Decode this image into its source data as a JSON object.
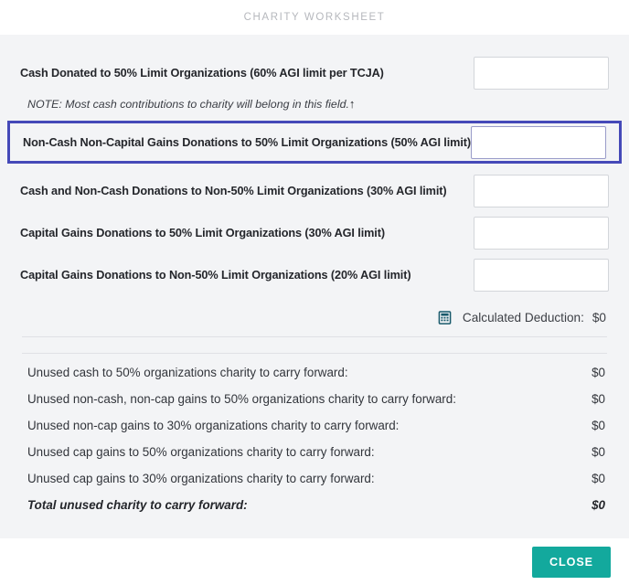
{
  "header": {
    "title": "CHARITY WORKSHEET"
  },
  "fields": [
    {
      "label": "Cash Donated to 50% Limit Organizations (60% AGI limit per TCJA)",
      "value": "",
      "placeholder": "",
      "highlighted": false
    },
    {
      "label": "Non-Cash Non-Capital Gains Donations to 50% Limit Organizations (50% AGI limit)",
      "value": "",
      "placeholder": "",
      "highlighted": true
    },
    {
      "label": "Cash and Non-Cash Donations to Non-50% Limit Organizations (30% AGI limit)",
      "value": "",
      "placeholder": "",
      "highlighted": false
    },
    {
      "label": "Capital Gains Donations to 50% Limit Organizations (30% AGI limit)",
      "value": "",
      "placeholder": "",
      "highlighted": false
    },
    {
      "label": "Capital Gains Donations to Non-50% Limit Organizations (20% AGI limit)",
      "value": "",
      "placeholder": "",
      "highlighted": false
    }
  ],
  "note": {
    "text": "NOTE: Most cash contributions to charity will belong in this field.",
    "arrow": "↑"
  },
  "calculated_deduction": {
    "icon": "calculator-icon",
    "label": "Calculated Deduction:",
    "value": "$0"
  },
  "carry_forward": [
    {
      "label": "Unused cash to 50% organizations charity to carry forward:",
      "value": "$0"
    },
    {
      "label": "Unused non-cash, non-cap gains to 50% organizations charity to carry forward:",
      "value": "$0"
    },
    {
      "label": "Unused non-cap gains to 30% organizations charity to carry forward:",
      "value": "$0"
    },
    {
      "label": "Unused cap gains to 50% organizations charity to carry forward:",
      "value": "$0"
    },
    {
      "label": "Unused cap gains to 30% organizations charity to carry forward:",
      "value": "$0"
    },
    {
      "label": "Total unused charity to carry forward:",
      "value": "$0"
    }
  ],
  "footer": {
    "close_label": "CLOSE"
  },
  "colors": {
    "accent_teal": "#13a99d",
    "highlight_blue": "#4549b8",
    "body_background": "#f3f4f6",
    "icon_teal": "#18596b"
  }
}
